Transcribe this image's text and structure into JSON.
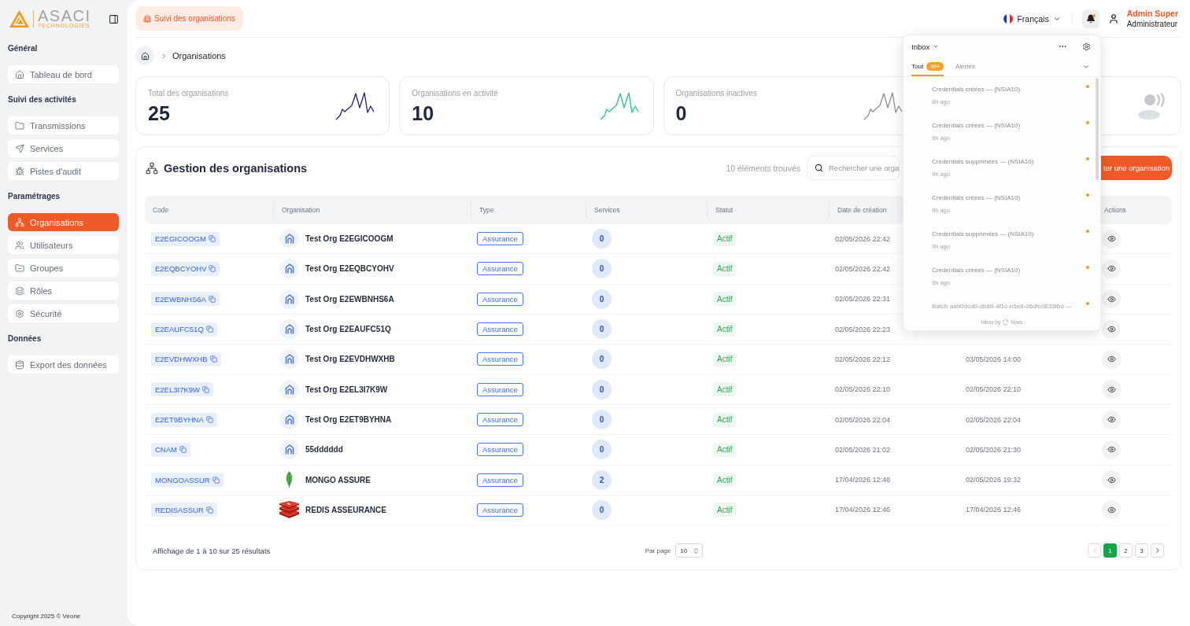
{
  "sidebar": {
    "logo": {
      "name": "ASACI",
      "tagline": "TECHNOLOGIES"
    },
    "sections": [
      {
        "title": "Général",
        "items": [
          {
            "kind": "home",
            "label": "Tableau de bord",
            "selected": false
          }
        ]
      },
      {
        "title": "Suivi des activités",
        "items": [
          {
            "kind": "folder",
            "label": "Transmissions",
            "selected": false
          },
          {
            "kind": "send",
            "label": "Services",
            "selected": false
          },
          {
            "kind": "bug",
            "label": "Pistes d'audit",
            "selected": false
          }
        ]
      },
      {
        "title": "Paramétrages",
        "items": [
          {
            "kind": "sitemap",
            "label": "Organisations",
            "selected": true
          },
          {
            "kind": "users",
            "label": "Utilisateurs",
            "selected": false
          },
          {
            "kind": "group",
            "label": "Groupes",
            "selected": false
          },
          {
            "kind": "layers",
            "label": "Rôles",
            "selected": false
          },
          {
            "kind": "gear",
            "label": "Sécurité",
            "selected": false
          }
        ]
      },
      {
        "title": "Données",
        "items": [
          {
            "kind": "database",
            "label": "Export des données",
            "selected": false
          }
        ]
      }
    ],
    "copyright": "Copyright 2025 © Veone"
  },
  "topbar": {
    "page_chip": "Suivi des organisations",
    "language": "Français",
    "bell": {
      "unread": true
    },
    "user": {
      "name": "Admin Super",
      "role": "Administrateur"
    }
  },
  "breadcrumb": {
    "current": "Organisations"
  },
  "stats": [
    {
      "kind": "sparkline",
      "label": "Total des organisations",
      "value": "25",
      "color": "#231f7a"
    },
    {
      "kind": "sparkline",
      "label": "Organisations en activité",
      "value": "10",
      "color": "#2ec08a"
    },
    {
      "kind": "sparkline",
      "label": "Organisations inactives",
      "value": "0",
      "color": "#8e8e8e"
    },
    {
      "kind": "icon"
    }
  ],
  "panel": {
    "title": "Gestion des organisations",
    "count": "10 éléments trouvés",
    "search": {
      "placeholder": "Rechercher une orga"
    },
    "add_button": "ter une organisation"
  },
  "table": {
    "columns": [
      "Code",
      "Organisation",
      "Type",
      "Services",
      "Statut",
      "Date de création",
      "Actions"
    ],
    "rows": [
      {
        "code": "E2EGICOOGM",
        "kind": "building",
        "name": "Test Org E2EGICOOGM",
        "type": "Assurance",
        "services": "0",
        "status": "Actif",
        "created": "02/05/2026 22:42"
      },
      {
        "code": "E2EQBCYOHV",
        "kind": "building",
        "name": "Test Org E2EQBCYOHV",
        "type": "Assurance",
        "services": "0",
        "status": "Actif",
        "created": "02/05/2026 22:42"
      },
      {
        "code": "E2EWBNHS6A",
        "kind": "building",
        "name": "Test Org E2EWBNHS6A",
        "type": "Assurance",
        "services": "0",
        "status": "Actif",
        "created": "02/05/2026 22:31"
      },
      {
        "code": "E2EAUFC51Q",
        "kind": "building",
        "name": "Test Org E2EAUFC51Q",
        "type": "Assurance",
        "services": "0",
        "status": "Actif",
        "created": "02/05/2026 22:23"
      },
      {
        "code": "E2EVDHWXHB",
        "kind": "building",
        "name": "Test Org E2EVDHWXHB",
        "type": "Assurance",
        "services": "0",
        "status": "Actif",
        "created": "02/05/2026 22:12",
        "modified": "03/05/2026 14:00"
      },
      {
        "code": "E2EL3I7K9W",
        "kind": "building",
        "name": "Test Org E2EL3I7K9W",
        "type": "Assurance",
        "services": "0",
        "status": "Actif",
        "created": "02/05/2026 22:10",
        "modified": "02/05/2026 22:10"
      },
      {
        "code": "E2ET9BYHNA",
        "kind": "building",
        "name": "Test Org E2ET9BYHNA",
        "type": "Assurance",
        "services": "0",
        "status": "Actif",
        "created": "02/05/2026 22:04",
        "modified": "02/05/2026 22:04"
      },
      {
        "code": "CNAM",
        "kind": "building",
        "name": "55dddddd",
        "type": "Assurance",
        "services": "0",
        "status": "Actif",
        "created": "02/05/2026 21:02",
        "modified": "02/05/2026 21:30"
      },
      {
        "code": "MONGOASSUR",
        "kind": "leaf",
        "name": "MONGO ASSURE",
        "type": "Assurance",
        "services": "2",
        "status": "Actif",
        "created": "17/04/2026 12:48",
        "modified": "02/05/2026 19:32"
      },
      {
        "code": "REDISASSUR",
        "kind": "cubes",
        "name": "REDIS ASSEURANCE",
        "type": "Assurance",
        "services": "0",
        "status": "Actif",
        "created": "17/04/2026 12:46",
        "modified": "17/04/2026 12:46"
      }
    ]
  },
  "footer": {
    "summary": "Affichage de 1 à 10 sur 25 résultats",
    "per_page": {
      "label": "Par page",
      "value": "10"
    },
    "prev": {
      "disabled": true
    },
    "pages": [
      {
        "label": "1",
        "selected": true
      },
      {
        "label": "2",
        "selected": false
      },
      {
        "label": "3",
        "selected": false
      }
    ],
    "next": {
      "disabled": false
    }
  },
  "inbox": {
    "title": "Inbox",
    "tabs": [
      {
        "label": "Tout",
        "badge": "99+",
        "selected": true
      },
      {
        "label": "Alertes",
        "selected": false
      }
    ],
    "notifications": [
      {
        "title": "Credentials créées — (NSIA10)",
        "time": "8h ago",
        "unread": true
      },
      {
        "title": "Credentials créées — (NSIA10)",
        "time": "9h ago",
        "unread": true
      },
      {
        "title": "Credentials supprimées — (NSIA10)",
        "time": "9h ago",
        "unread": true
      },
      {
        "title": "Credentials créées — (NSIA10)",
        "time": "9h ago",
        "unread": true
      },
      {
        "title": "Credentials supprimées — (NSIA10)",
        "time": "9h ago",
        "unread": true
      },
      {
        "title": "Credentials créées — (NSIA10)",
        "time": "9h ago",
        "unread": true
      },
      {
        "title": "Batch aa90dcd0-db89-4f1c-b5e8-06dfcd633f6d —",
        "unread": true
      }
    ],
    "footer": {
      "prefix": "Inbox by",
      "name": "Novu"
    }
  }
}
